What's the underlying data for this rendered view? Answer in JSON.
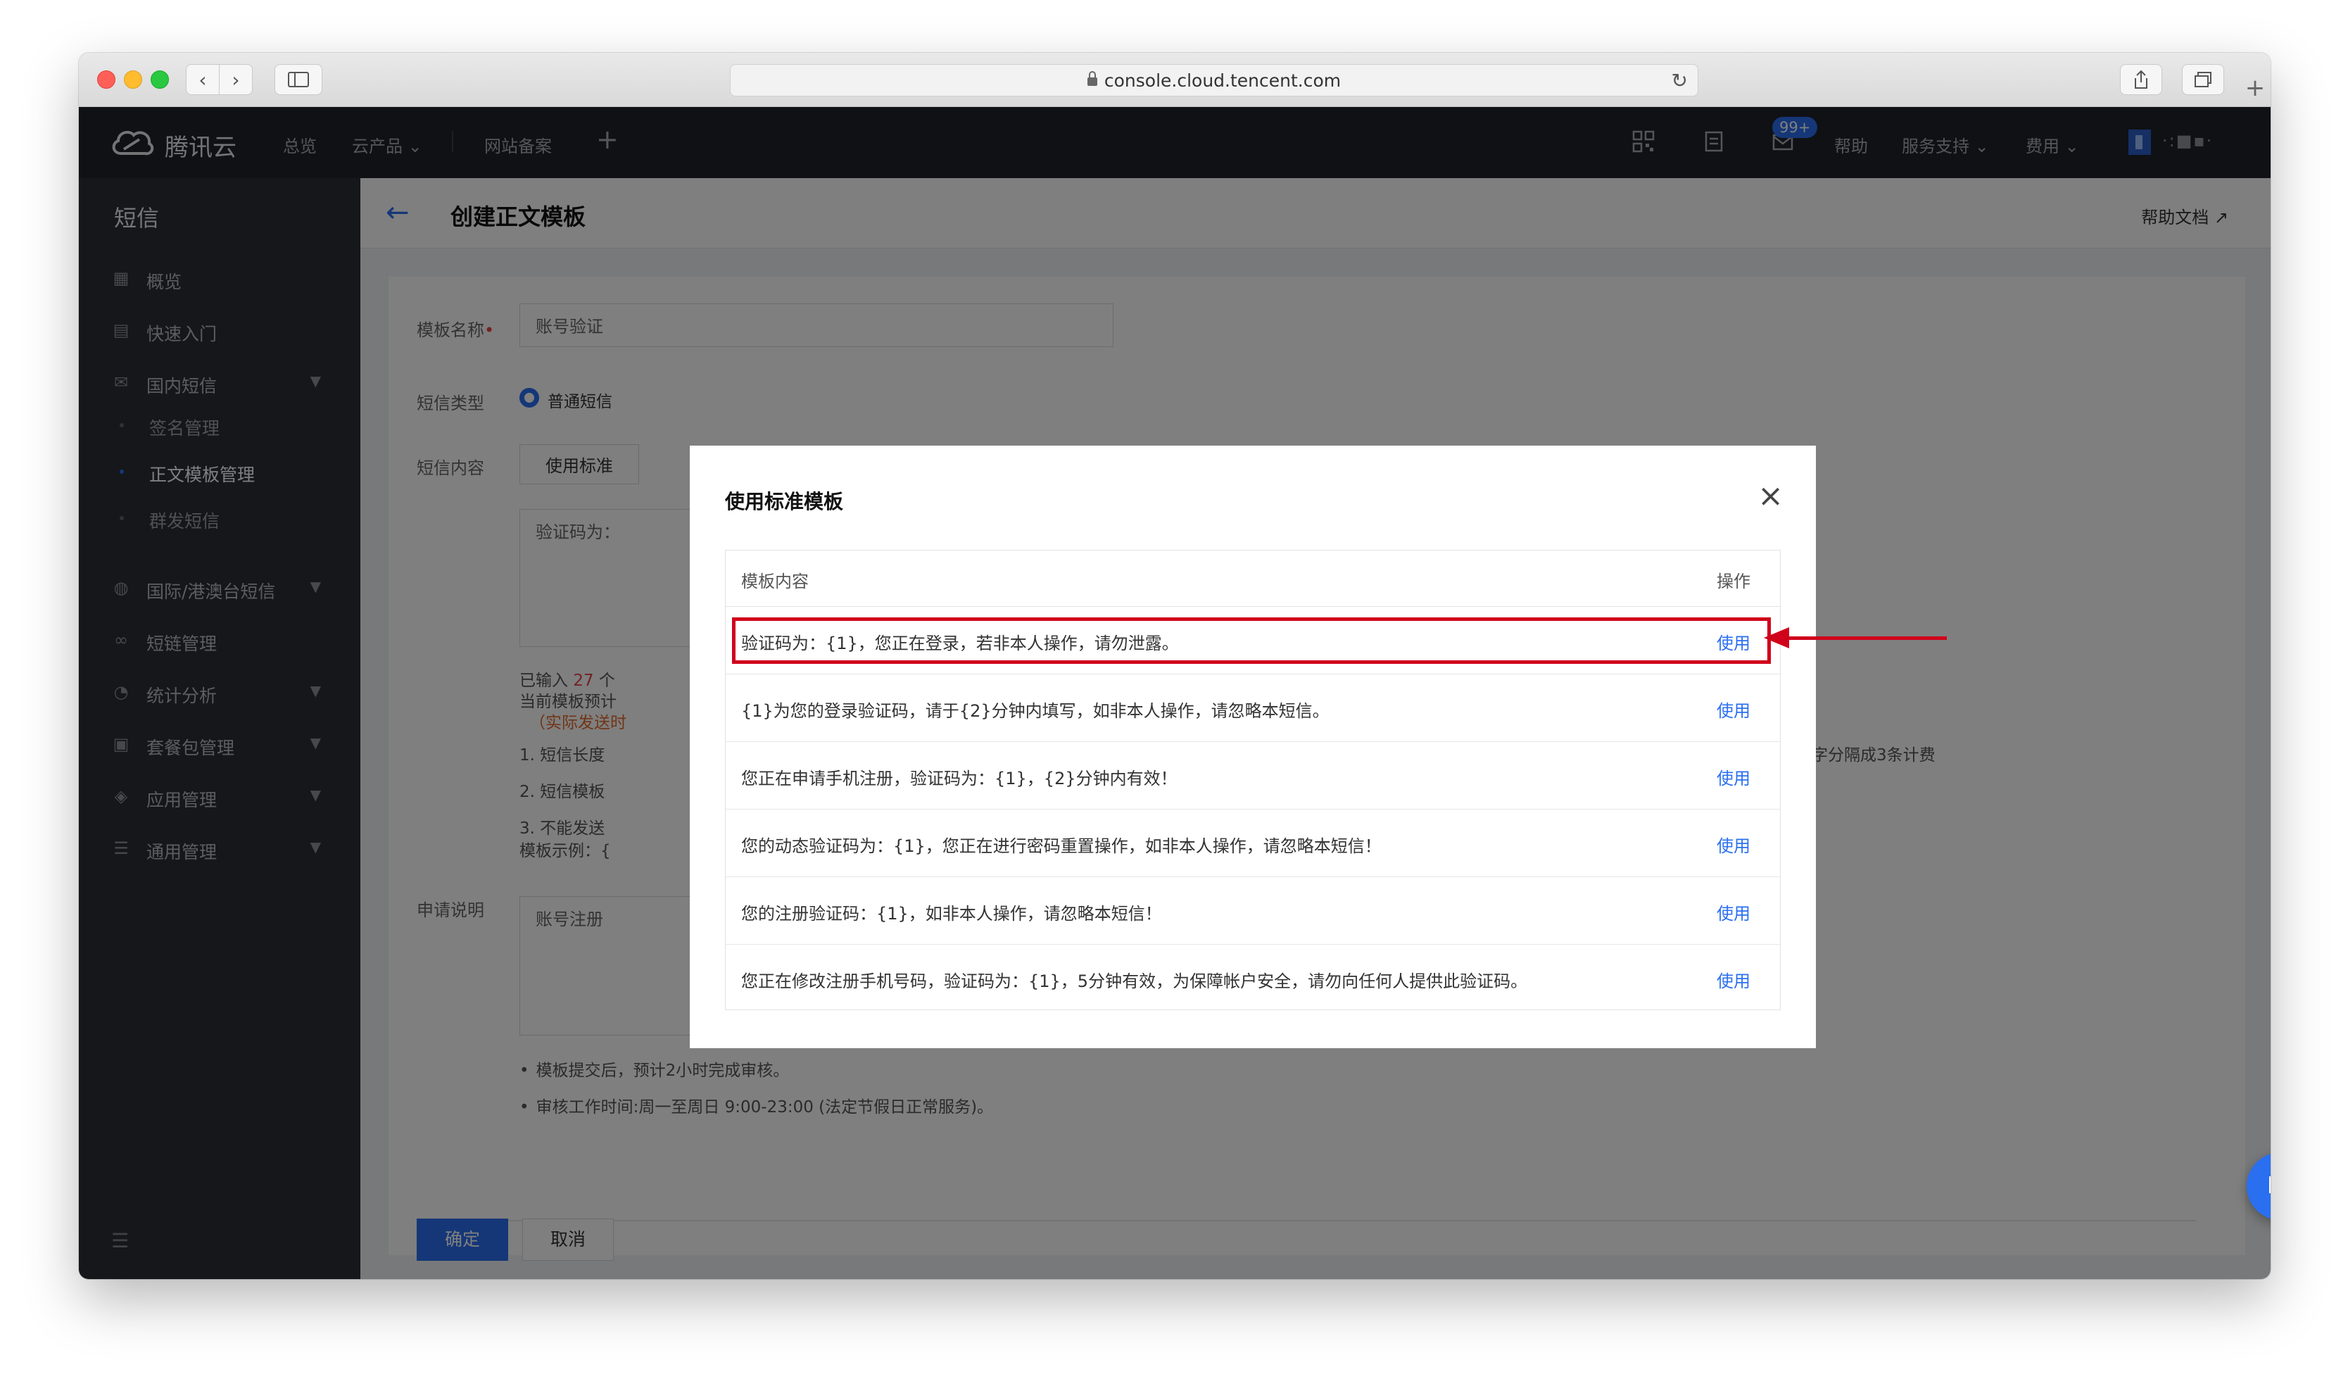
{
  "browser": {
    "url": "console.cloud.tencent.com"
  },
  "topbar": {
    "logo_text": "腾讯云",
    "nav": [
      "总览",
      "云产品",
      "网站备案"
    ],
    "badge": "99+",
    "help": "帮助",
    "support": "服务支持",
    "fee": "费用",
    "account": "·:■▪·"
  },
  "sidebar": {
    "title": "短信",
    "items": [
      {
        "label": "概览",
        "icon": "grid-icon"
      },
      {
        "label": "快速入门",
        "icon": "book-icon"
      },
      {
        "label": "国内短信",
        "icon": "mail-icon",
        "chevron": true
      },
      {
        "label": "国际/港澳台短信",
        "icon": "globe-icon",
        "chevron": true
      },
      {
        "label": "短链管理",
        "icon": "link-icon"
      },
      {
        "label": "统计分析",
        "icon": "pie-chart-icon",
        "chevron": true
      },
      {
        "label": "套餐包管理",
        "icon": "package-icon",
        "chevron": true
      },
      {
        "label": "应用管理",
        "icon": "layers-icon",
        "chevron": true
      },
      {
        "label": "通用管理",
        "icon": "sliders-icon",
        "chevron": true
      }
    ],
    "subitems": [
      {
        "label": "签名管理",
        "active": false
      },
      {
        "label": "正文模板管理",
        "active": true
      },
      {
        "label": "群发短信",
        "active": false
      }
    ]
  },
  "page": {
    "title": "创建正文模板",
    "help_doc": "帮助文档"
  },
  "form": {
    "name_label": "模板名称",
    "name_value": "账号验证",
    "type_label": "短信类型",
    "type_value": "普通短信",
    "content_label": "短信内容",
    "use_std_btn": "使用标准",
    "content_value": "验证码为：",
    "count_prefix": "已输入",
    "count_value": "27",
    "count_suffix": "个",
    "preview_text": "当前模板预计",
    "actual_text": "（实际发送时",
    "rule1": "1. 短信长度",
    "rule1_tail": "字分隔成3条计费",
    "rule2": "2. 短信模板",
    "rule3": "3. 不能发送",
    "example": "模板示例：{",
    "apply_label": "申请说明",
    "apply_value": "账号注册",
    "note1": "模板提交后，预计2小时完成审核。",
    "note2": "审核工作时间:周一至周日 9:00-23:00 (法定节假日正常服务)。",
    "confirm": "确定",
    "cancel": "取消"
  },
  "modal": {
    "title": "使用标准模板",
    "col_content": "模板内容",
    "col_action": "操作",
    "rows": [
      {
        "text": "验证码为：{1}，您正在登录，若非本人操作，请勿泄露。",
        "action": "使用"
      },
      {
        "text": "{1}为您的登录验证码，请于{2}分钟内填写，如非本人操作，请忽略本短信。",
        "action": "使用"
      },
      {
        "text": "您正在申请手机注册，验证码为：{1}，{2}分钟内有效！",
        "action": "使用"
      },
      {
        "text": "您的动态验证码为：{1}，您正在进行密码重置操作，如非本人操作，请忽略本短信！",
        "action": "使用"
      },
      {
        "text": "您的注册验证码：{1}，如非本人操作，请忽略本短信！",
        "action": "使用"
      },
      {
        "text": "您正在修改注册手机号码，验证码为：{1}，5分钟有效，为保障帐户安全，请勿向任何人提供此验证码。",
        "action": "使用"
      }
    ]
  },
  "colors": {
    "accent": "#2a6ff0",
    "highlight": "#d0021b",
    "sidebar_bg": "#2b2f37",
    "topbar_bg": "#1e222b"
  }
}
